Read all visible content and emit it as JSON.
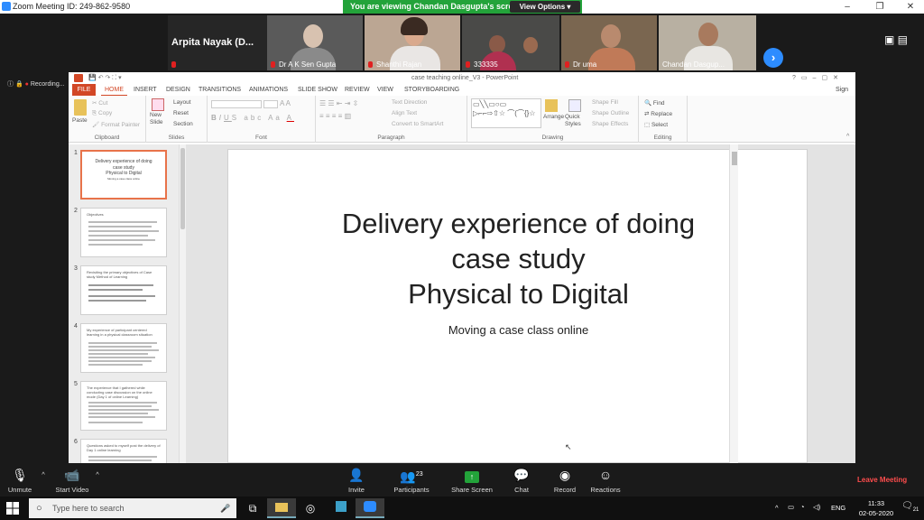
{
  "zoom": {
    "title": "Zoom Meeting ID: 249-862-9580",
    "banner": "You are viewing Chandan Dasgupta's screen",
    "view_options": "View Options",
    "view_options_arrow": "▾",
    "participants_tiles": [
      {
        "name": "Arpita Nayak (D..."
      },
      {
        "name": "Dr A K Sen Gupta"
      },
      {
        "name": "Shanthi Rajan"
      },
      {
        "name": "333335"
      },
      {
        "name": "Dr uma"
      },
      {
        "name": "Chandan Dasgup..."
      }
    ],
    "recording_label": "Recording...",
    "toolbar": {
      "unmute": "Unmute",
      "start_video": "Start Video",
      "invite": "Invite",
      "participants": "Participants",
      "participants_count": "23",
      "share_screen": "Share Screen",
      "chat": "Chat",
      "record": "Record",
      "reactions": "Reactions",
      "leave": "Leave Meeting"
    },
    "accent": "#2d8cff",
    "banner_color": "#23a33a"
  },
  "ppt": {
    "window_title": "case teaching online_V3 - PowerPoint",
    "win_controls": [
      "?",
      "▭",
      "–",
      "▢",
      "✕"
    ],
    "sign_in": "Sign in",
    "tabs": [
      "FILE",
      "HOME",
      "INSERT",
      "DESIGN",
      "TRANSITIONS",
      "ANIMATIONS",
      "SLIDE SHOW",
      "REVIEW",
      "VIEW",
      "STORYBOARDING"
    ],
    "ribbon": {
      "paste": "Paste",
      "cut": "Cut",
      "copy": "Copy",
      "format_painter": "Format Painter",
      "clipboard": "Clipboard",
      "new_slide": "New Slide",
      "layout": "Layout",
      "reset": "Reset",
      "section": "Section",
      "slides": "Slides",
      "font": "Font",
      "text_direction": "Text Direction",
      "align_text": "Align Text",
      "convert_smartart": "Convert to SmartArt",
      "paragraph": "Paragraph",
      "arrange": "Arrange",
      "quick_styles": "Quick Styles",
      "shape_fill": "Shape Fill",
      "shape_outline": "Shape Outline",
      "shape_effects": "Shape Effects",
      "drawing": "Drawing",
      "find": "Find",
      "replace": "Replace",
      "select": "Select",
      "editing": "Editing",
      "bold": "B",
      "italic": "I",
      "underline": "U",
      "strike": "S",
      "abc": "abc",
      "aa": "Aa",
      "font_color": "A"
    },
    "thumb_numbers": [
      "1",
      "2",
      "3",
      "4",
      "5",
      "6"
    ],
    "thumb1_lines": [
      "Delivery experience of doing",
      "case study",
      "Physical to Digital",
      "Moving a case class online"
    ],
    "thumb2_title": "Objectives",
    "thumb3_title": "Revisiting the primary objectives of Case study Method of Learning",
    "thumb4_title": "My experience of participant centered learning in a physical classroom situation",
    "thumb5_title": "The experience that I gathered while conducting case discussion on the online mode (Day 1 of online Learning)",
    "thumb6_title": "Questions asked to myself post the delivery of Day 1 online learning",
    "slide_title_lines": [
      "Delivery experience of doing",
      "case study",
      "Physical to Digital"
    ],
    "slide_subtitle": "Moving a case class online"
  },
  "taskbar": {
    "search_placeholder": "Type here to search",
    "lang": "ENG",
    "time": "11:33",
    "date": "02-05-2020",
    "notifications": "21"
  }
}
